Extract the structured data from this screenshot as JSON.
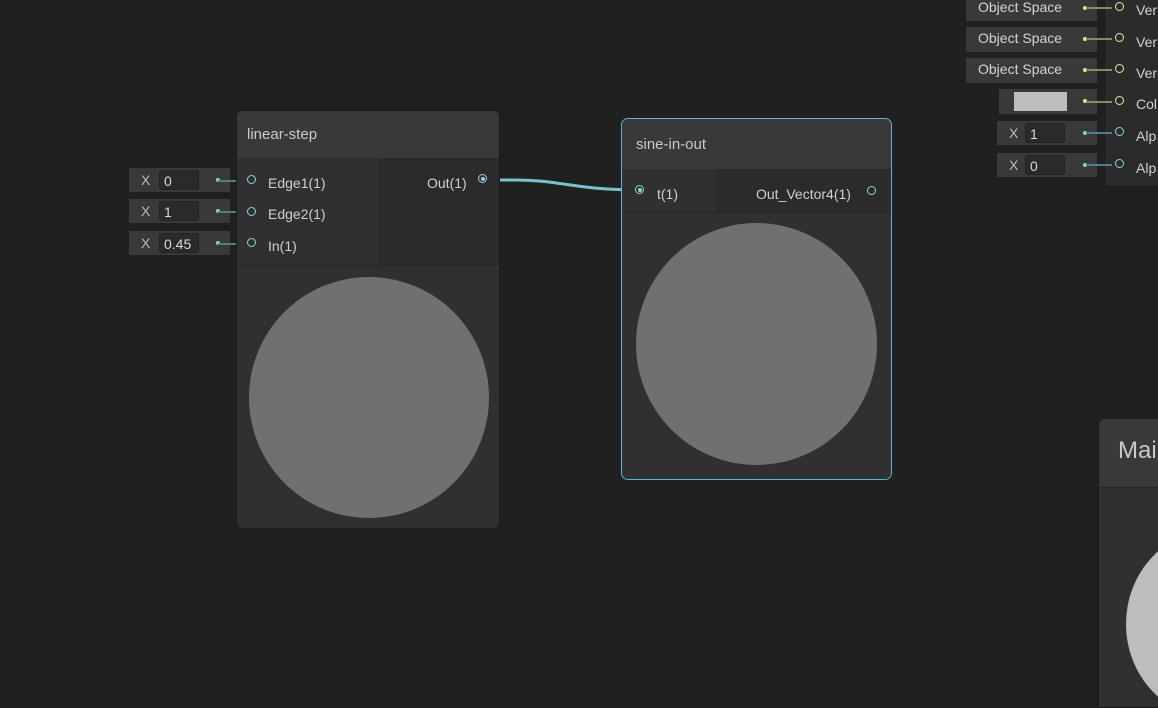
{
  "nodes": {
    "linear_step": {
      "title": "linear-step",
      "inputs": [
        "Edge1(1)",
        "Edge2(1)",
        "In(1)"
      ],
      "output": "Out(1)",
      "input_fields": [
        {
          "axis": "X",
          "value": "0"
        },
        {
          "axis": "X",
          "value": "1"
        },
        {
          "axis": "X",
          "value": "0.45"
        }
      ]
    },
    "sine_in_out": {
      "title": "sine-in-out",
      "input": "t(1)",
      "output": "Out_Vector4(1)"
    },
    "master": {
      "title_partial": "Mai",
      "port_labels": [
        "Ver",
        "Ver",
        "Ver",
        "Col",
        "Alp",
        "Alp"
      ],
      "object_space_label": "Object Space",
      "field_1": {
        "axis": "X",
        "value": "1"
      },
      "field_2": {
        "axis": "X",
        "value": "0"
      },
      "color_swatch": "#bdbdbd"
    }
  },
  "colors": {
    "background": "#202020",
    "wire": "#79c2cc",
    "selection": "#5bb5d6",
    "port_cyan": "#8fd3dc",
    "port_yellow": "#e8e8a8"
  }
}
